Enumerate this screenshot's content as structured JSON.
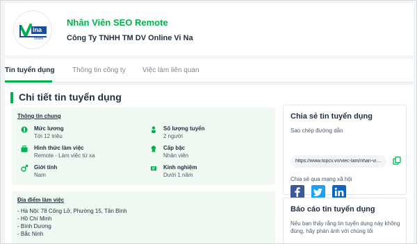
{
  "header": {
    "job_title": "Nhân Viên SEO Remote",
    "company_name": "Công Ty TNHH TM DV Online Vi Na",
    "logo": {
      "icon": "vina-online-logo",
      "brand_text": "ina",
      "sub_text": "online"
    }
  },
  "tabs": [
    {
      "label": "Tin tuyển dụng",
      "active": true
    },
    {
      "label": "Thông tin công ty",
      "active": false
    },
    {
      "label": "Việc làm liên quan",
      "active": false
    }
  ],
  "detail": {
    "section_title": "Chi tiết tin tuyển dụng",
    "general_title": "Thông tin chung",
    "items": [
      {
        "label": "Mức lương",
        "value": "Tới 12 triệu",
        "icon": "salary-icon"
      },
      {
        "label": "Số lượng tuyển",
        "value": "2 người",
        "icon": "people-icon"
      },
      {
        "label": "Hình thức làm việc",
        "value": "Remote - Làm việc từ xa",
        "icon": "work-type-icon"
      },
      {
        "label": "Cấp bậc",
        "value": "Nhân viên",
        "icon": "level-icon"
      },
      {
        "label": "Giới tính",
        "value": "Nam",
        "icon": "gender-icon"
      },
      {
        "label": "Kinh nghiệm",
        "value": "Dưới 1 năm",
        "icon": "experience-icon"
      }
    ],
    "location_title": "Địa điểm làm việc",
    "locations": [
      "- Hà Nội: 78 Cống Lở, Phường 15, Tân Bình",
      "- Hồ Chí Minh",
      "- Bình Dương",
      "- Bắc Ninh"
    ]
  },
  "share": {
    "title": "Chia sẻ tin tuyển dụng",
    "copy_label": "Sao chép đường dẫn",
    "link": "https://www.topcv.vn/viec-lam/nhan-vien-seo-remote",
    "social_label": "Chia sẻ qua mạng xã hội",
    "networks": [
      {
        "name": "facebook-icon",
        "color": "#3b5998"
      },
      {
        "name": "twitter-icon",
        "color": "#1da1f2"
      },
      {
        "name": "linkedin-icon",
        "color": "#0a66c2"
      }
    ]
  },
  "report": {
    "title": "Báo cáo tin tuyển dụng",
    "line1": "Nếu bạn thấy rằng tin tuyển dụng này không",
    "line2": "đúng, hãy phản ánh với chúng tôi"
  },
  "colors": {
    "accent": "#00b14f",
    "text": "#212f3f",
    "muted": "#7f878f",
    "panel": "#f0f8f2"
  }
}
